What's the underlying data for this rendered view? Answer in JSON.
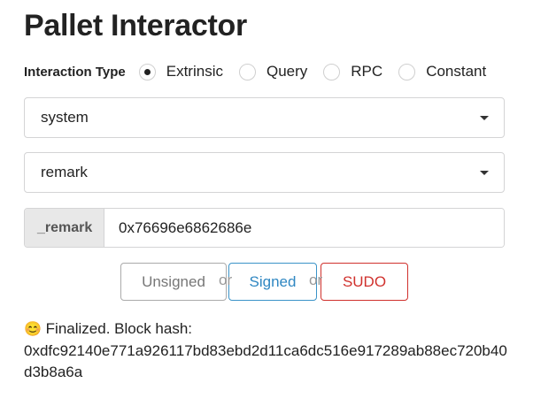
{
  "title": "Pallet Interactor",
  "interaction": {
    "label": "Interaction Type",
    "options": [
      "Extrinsic",
      "Query",
      "RPC",
      "Constant"
    ],
    "selected": "Extrinsic"
  },
  "pallet_select": {
    "value": "system"
  },
  "callable_select": {
    "value": "remark"
  },
  "param": {
    "label": "_remark",
    "value": "0x76696e6862686e"
  },
  "buttons": {
    "unsigned": "Unsigned",
    "or1": "or",
    "signed": "Signed",
    "or2": "or",
    "sudo": "SUDO"
  },
  "status": {
    "icon": "😊",
    "line1": "Finalized. Block hash:",
    "hash": "0xdfc92140e771a926117bd83ebd2d11ca6dc516e917289ab88ec720b40d3b8a6a"
  }
}
